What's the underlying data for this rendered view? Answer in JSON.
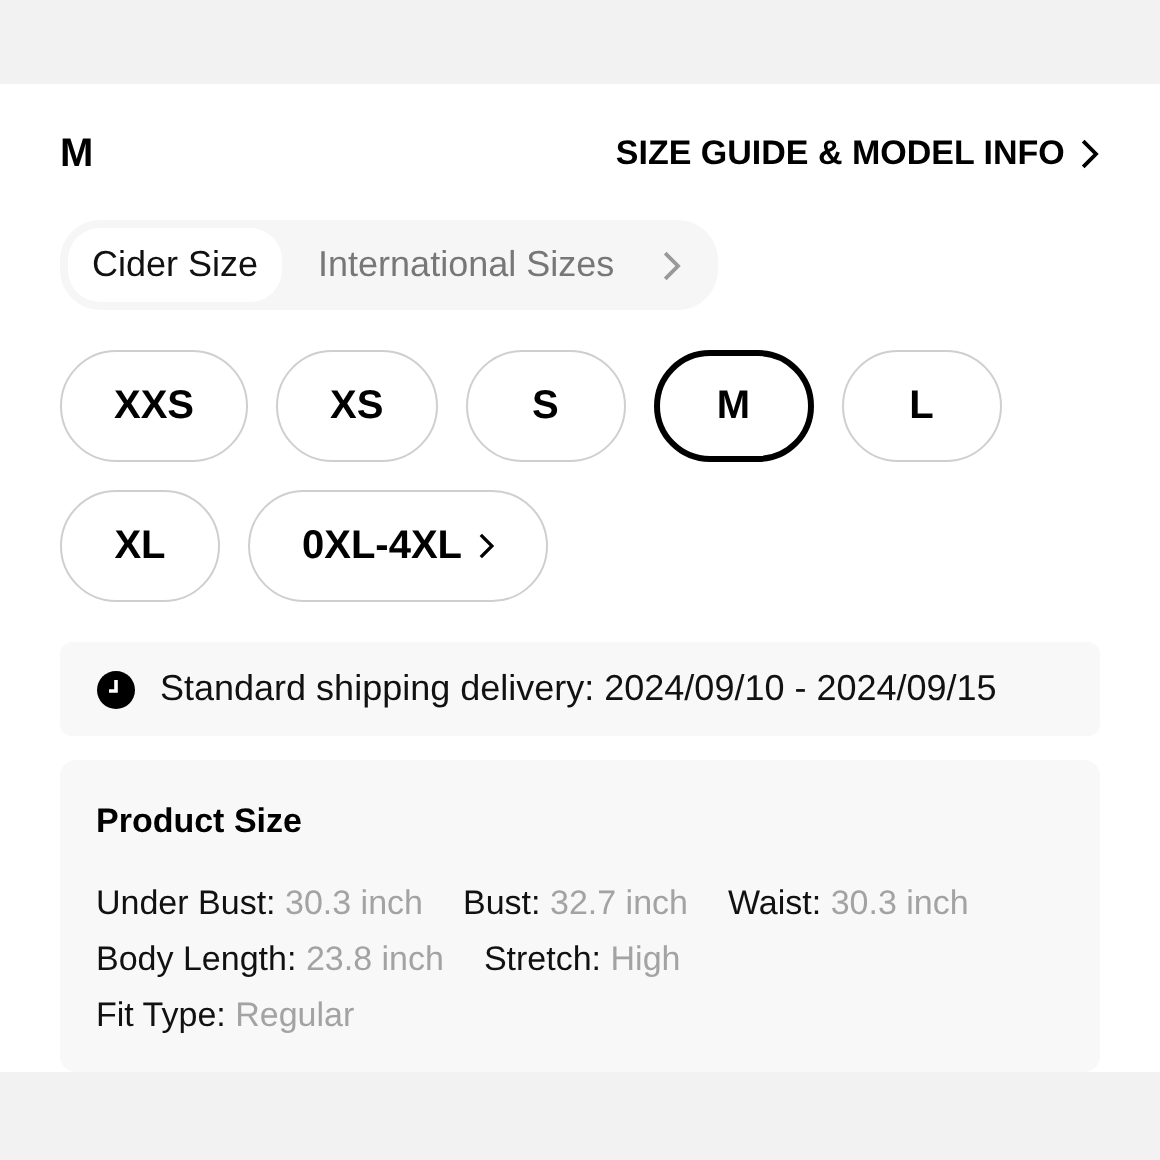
{
  "header": {
    "selected_size": "M",
    "guide_link": "SIZE GUIDE & MODEL INFO"
  },
  "size_tabs": [
    {
      "label": "Cider Size",
      "selected": true
    },
    {
      "label": "International Sizes",
      "selected": false
    }
  ],
  "sizes": [
    {
      "label": "XXS",
      "selected": false,
      "kind": "size"
    },
    {
      "label": "XS",
      "selected": false,
      "kind": "size"
    },
    {
      "label": "S",
      "selected": false,
      "kind": "size"
    },
    {
      "label": "M",
      "selected": true,
      "kind": "size"
    },
    {
      "label": "L",
      "selected": false,
      "kind": "size"
    },
    {
      "label": "XL",
      "selected": false,
      "kind": "size"
    },
    {
      "label": "0XL-4XL",
      "selected": false,
      "kind": "more"
    }
  ],
  "shipping": "Standard shipping delivery: 2024/09/10 - 2024/09/15",
  "product_size": {
    "title": "Product Size",
    "rows": [
      [
        {
          "label": "Under Bust:",
          "value": "30.3 inch"
        },
        {
          "label": "Bust:",
          "value": "32.7 inch"
        },
        {
          "label": "Waist:",
          "value": "30.3 inch"
        }
      ],
      [
        {
          "label": "Body Length:",
          "value": "23.8 inch"
        },
        {
          "label": "Stretch:",
          "value": "High"
        }
      ],
      [
        {
          "label": "Fit Type:",
          "value": "Regular"
        }
      ]
    ]
  }
}
